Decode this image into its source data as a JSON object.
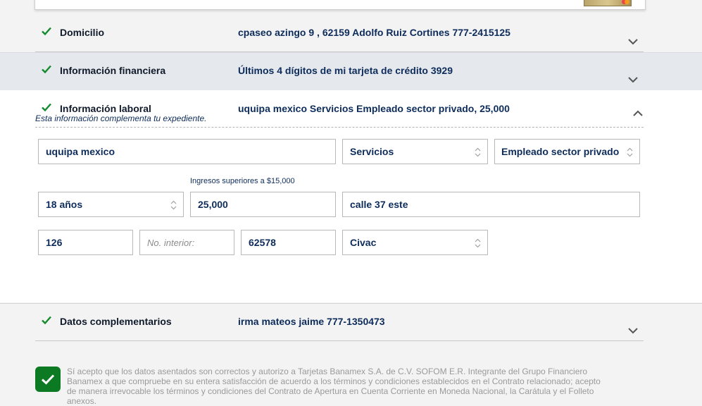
{
  "sections": {
    "domicilio": {
      "title": "Domicilio",
      "summary": "cpaseo azingo 9 , 62159 Adolfo Ruiz Cortines 777-2415125"
    },
    "financiera": {
      "title": "Información financiera",
      "summary": "Últimos 4 dígitos de mi tarjeta de crédito 3929"
    },
    "laboral": {
      "title": "Información laboral",
      "summary": "uquipa mexico Servicios Empleado sector privado, 25,000",
      "note": "Esta información complementa tu expediente.",
      "fields": {
        "company": "uquipa mexico",
        "sector": "Servicios",
        "employment_type": "Empleado sector privado",
        "seniority": "18 años",
        "income_label": "Ingresos superiores a $15,000",
        "income": "25,000",
        "street": "calle 37 este",
        "ext_number": "126",
        "int_number_placeholder": "No. interior:",
        "postal_code": "62578",
        "neighborhood": "Civac"
      }
    },
    "complementarios": {
      "title": "Datos complementarios",
      "summary": "irma mateos jaime 777-1350473"
    }
  },
  "consent": {
    "checked": true,
    "text": "Sí acepto que los datos asentados son correctos y autorizo a Tarjetas Banamex S.A. de C.V. SOFOM E.R. Integrante del Grupo Financiero Banamex a que compruebe en su entera satisfacción de acuerdo a los términos y condiciones establecidos en el Contrato relacionado; acepto de manera irrevocable los términos y condiciones del Contrato de Apertura en Cuenta Corriente en Moneda Nacional, la Carátula y el Folleto anexos."
  },
  "colors": {
    "check": "#138a2e",
    "navy": "#0d2c5b",
    "consent_green": "#0c7a23"
  },
  "icons": {
    "check": "check-icon",
    "chevron_down": "chevron-down-icon",
    "chevron_up": "chevron-up-icon",
    "select_arrows": "select-arrows-icon"
  }
}
